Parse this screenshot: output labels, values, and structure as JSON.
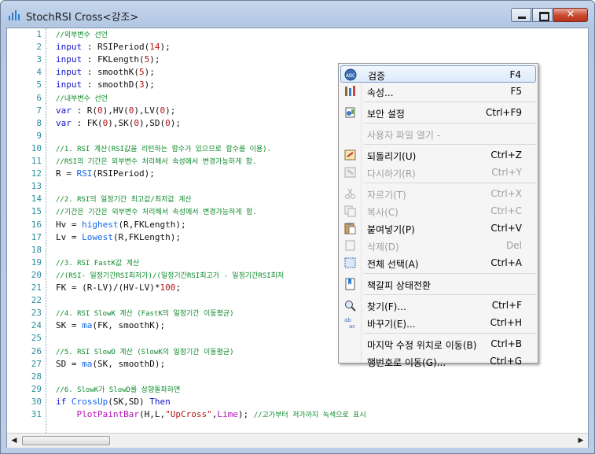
{
  "window": {
    "title": "StochRSI Cross<강조>",
    "close_glyph": "✕"
  },
  "editor": {
    "lines": [
      {
        "n": "1",
        "segs": [
          {
            "t": "//외부변수 선언",
            "c": "cm"
          }
        ]
      },
      {
        "n": "2",
        "segs": [
          {
            "t": "input",
            "c": "kw"
          },
          {
            "t": " : RSIPeriod(",
            "c": ""
          },
          {
            "t": "14",
            "c": "num"
          },
          {
            "t": ");",
            "c": ""
          }
        ]
      },
      {
        "n": "3",
        "segs": [
          {
            "t": "input",
            "c": "kw"
          },
          {
            "t": " : FKLength(",
            "c": ""
          },
          {
            "t": "5",
            "c": "num"
          },
          {
            "t": ");",
            "c": ""
          }
        ]
      },
      {
        "n": "4",
        "segs": [
          {
            "t": "input",
            "c": "kw"
          },
          {
            "t": " : smoothK(",
            "c": ""
          },
          {
            "t": "5",
            "c": "num"
          },
          {
            "t": ");",
            "c": ""
          }
        ]
      },
      {
        "n": "5",
        "segs": [
          {
            "t": "input",
            "c": "kw"
          },
          {
            "t": " : smoothD(",
            "c": ""
          },
          {
            "t": "3",
            "c": "num"
          },
          {
            "t": ");",
            "c": ""
          }
        ]
      },
      {
        "n": "6",
        "segs": [
          {
            "t": "//내부변수 선언",
            "c": "cm"
          }
        ]
      },
      {
        "n": "7",
        "segs": [
          {
            "t": "var",
            "c": "kw"
          },
          {
            "t": " : R(",
            "c": ""
          },
          {
            "t": "0",
            "c": "num"
          },
          {
            "t": "),HV(",
            "c": ""
          },
          {
            "t": "0",
            "c": "num"
          },
          {
            "t": "),LV(",
            "c": ""
          },
          {
            "t": "0",
            "c": "num"
          },
          {
            "t": ");",
            "c": ""
          }
        ]
      },
      {
        "n": "8",
        "segs": [
          {
            "t": "var",
            "c": "kw"
          },
          {
            "t": " : FK(",
            "c": ""
          },
          {
            "t": "0",
            "c": "num"
          },
          {
            "t": "),SK(",
            "c": ""
          },
          {
            "t": "0",
            "c": "num"
          },
          {
            "t": "),SD(",
            "c": ""
          },
          {
            "t": "0",
            "c": "num"
          },
          {
            "t": ");",
            "c": ""
          }
        ]
      },
      {
        "n": "9",
        "segs": []
      },
      {
        "n": "10",
        "segs": [
          {
            "t": "//1. RSI 계산(RSI값을 리턴하는 함수가 있으므로 함수를 이용).",
            "c": "cm"
          }
        ]
      },
      {
        "n": "11",
        "segs": [
          {
            "t": "//RSI의 기간은 외부변수 처리해서 속성에서 변경가능하게 함.",
            "c": "cm"
          }
        ]
      },
      {
        "n": "12",
        "segs": [
          {
            "t": "R = ",
            "c": ""
          },
          {
            "t": "RSI",
            "c": "fn"
          },
          {
            "t": "(RSIPeriod);",
            "c": ""
          }
        ]
      },
      {
        "n": "13",
        "segs": []
      },
      {
        "n": "14",
        "segs": [
          {
            "t": "//2. RSI의 일정기간 최고값/최저값 계산",
            "c": "cm"
          }
        ]
      },
      {
        "n": "15",
        "segs": [
          {
            "t": "//기간은 기간은 외부변수 처리해서 속성에서 변경가능하게 함.",
            "c": "cm"
          }
        ]
      },
      {
        "n": "16",
        "segs": [
          {
            "t": "Hv = ",
            "c": ""
          },
          {
            "t": "highest",
            "c": "fn"
          },
          {
            "t": "(R,FKLength);",
            "c": ""
          }
        ]
      },
      {
        "n": "17",
        "segs": [
          {
            "t": "Lv = ",
            "c": ""
          },
          {
            "t": "Lowest",
            "c": "fn"
          },
          {
            "t": "(R,FKLength);",
            "c": ""
          }
        ]
      },
      {
        "n": "18",
        "segs": []
      },
      {
        "n": "19",
        "segs": [
          {
            "t": "//3. RSI FastK값 계산",
            "c": "cm"
          }
        ]
      },
      {
        "n": "20",
        "segs": [
          {
            "t": "//(RSI- 일정기간RSI최저가)/(일정기간RSI최고가 - 일정기간RSI최저",
            "c": "cm"
          }
        ]
      },
      {
        "n": "21",
        "segs": [
          {
            "t": "FK = (R-LV)/(HV-LV)*",
            "c": ""
          },
          {
            "t": "100",
            "c": "num"
          },
          {
            "t": ";",
            "c": ""
          }
        ]
      },
      {
        "n": "22",
        "segs": []
      },
      {
        "n": "23",
        "segs": [
          {
            "t": "//4. RSI SlowK 계산 (FastK의 일정기간 이동평균)",
            "c": "cm"
          }
        ]
      },
      {
        "n": "24",
        "segs": [
          {
            "t": "SK = ",
            "c": ""
          },
          {
            "t": "ma",
            "c": "fn"
          },
          {
            "t": "(FK, smoothK);",
            "c": ""
          }
        ]
      },
      {
        "n": "25",
        "segs": []
      },
      {
        "n": "26",
        "segs": [
          {
            "t": "//5. RSI SlowD 계산 (SlowK의 일정기간 이동평균)",
            "c": "cm"
          }
        ]
      },
      {
        "n": "27",
        "segs": [
          {
            "t": "SD = ",
            "c": ""
          },
          {
            "t": "ma",
            "c": "fn"
          },
          {
            "t": "(SK, smoothD);",
            "c": ""
          }
        ]
      },
      {
        "n": "28",
        "segs": []
      },
      {
        "n": "29",
        "segs": [
          {
            "t": "//6. SlowK가 SlowD를 상향돌파하면",
            "c": "cm"
          }
        ]
      },
      {
        "n": "30",
        "segs": [
          {
            "t": "if",
            "c": "kw"
          },
          {
            "t": " ",
            "c": ""
          },
          {
            "t": "CrossUp",
            "c": "fn"
          },
          {
            "t": "(SK,SD) ",
            "c": ""
          },
          {
            "t": "Then",
            "c": "kw"
          }
        ]
      },
      {
        "n": "31",
        "segs": [
          {
            "t": "    ",
            "c": ""
          },
          {
            "t": "PlotPaintBar",
            "c": "plot"
          },
          {
            "t": "(H,L,",
            "c": ""
          },
          {
            "t": "\"UpCross\"",
            "c": "str"
          },
          {
            "t": ",",
            "c": ""
          },
          {
            "t": "Lime",
            "c": "plot"
          },
          {
            "t": "); ",
            "c": ""
          },
          {
            "t": "//고가부터 저가까지 녹색으로 표시",
            "c": "cm"
          }
        ]
      }
    ]
  },
  "context_menu": {
    "items": [
      {
        "type": "item",
        "label": "검증",
        "shortcut": "F4",
        "icon": "abc-check-icon",
        "highlighted": true
      },
      {
        "type": "item",
        "label": "속성...",
        "shortcut": "F5",
        "icon": "properties-icon"
      },
      {
        "type": "sep"
      },
      {
        "type": "item",
        "label": "보안 설정",
        "shortcut": "Ctrl+F9",
        "icon": "security-icon"
      },
      {
        "type": "sep"
      },
      {
        "type": "item",
        "label": "사용자 파일 열기 -",
        "shortcut": "",
        "disabled": true
      },
      {
        "type": "sep"
      },
      {
        "type": "item",
        "label": "되돌리기(U)",
        "shortcut": "Ctrl+Z",
        "icon": "undo-icon"
      },
      {
        "type": "item",
        "label": "다시하기(R)",
        "shortcut": "Ctrl+Y",
        "icon": "redo-icon",
        "disabled": true
      },
      {
        "type": "sep"
      },
      {
        "type": "item",
        "label": "자르기(T)",
        "shortcut": "Ctrl+X",
        "icon": "cut-icon",
        "disabled": true
      },
      {
        "type": "item",
        "label": "복사(C)",
        "shortcut": "Ctrl+C",
        "icon": "copy-icon",
        "disabled": true
      },
      {
        "type": "item",
        "label": "붙여넣기(P)",
        "shortcut": "Ctrl+V",
        "icon": "paste-icon"
      },
      {
        "type": "item",
        "label": "삭제(D)",
        "shortcut": "Del",
        "icon": "delete-icon",
        "disabled": true
      },
      {
        "type": "item",
        "label": "전체 선택(A)",
        "shortcut": "Ctrl+A",
        "icon": "select-all-icon"
      },
      {
        "type": "sep"
      },
      {
        "type": "item",
        "label": "책갈피 상태전환",
        "shortcut": "",
        "icon": "bookmark-icon"
      },
      {
        "type": "sep"
      },
      {
        "type": "item",
        "label": "찾기(F)...",
        "shortcut": "Ctrl+F",
        "icon": "find-icon"
      },
      {
        "type": "item",
        "label": "바꾸기(E)...",
        "shortcut": "Ctrl+H",
        "icon": "replace-icon"
      },
      {
        "type": "sep"
      },
      {
        "type": "item",
        "label": "마지막 수정 위치로 이동(B)",
        "shortcut": "Ctrl+B",
        "icon": ""
      },
      {
        "type": "item",
        "label": "행번호로 이동(G)...",
        "shortcut": "Ctrl+G",
        "icon": ""
      }
    ]
  },
  "scrollbar": {
    "left_arrow": "◀",
    "right_arrow": "▶"
  }
}
